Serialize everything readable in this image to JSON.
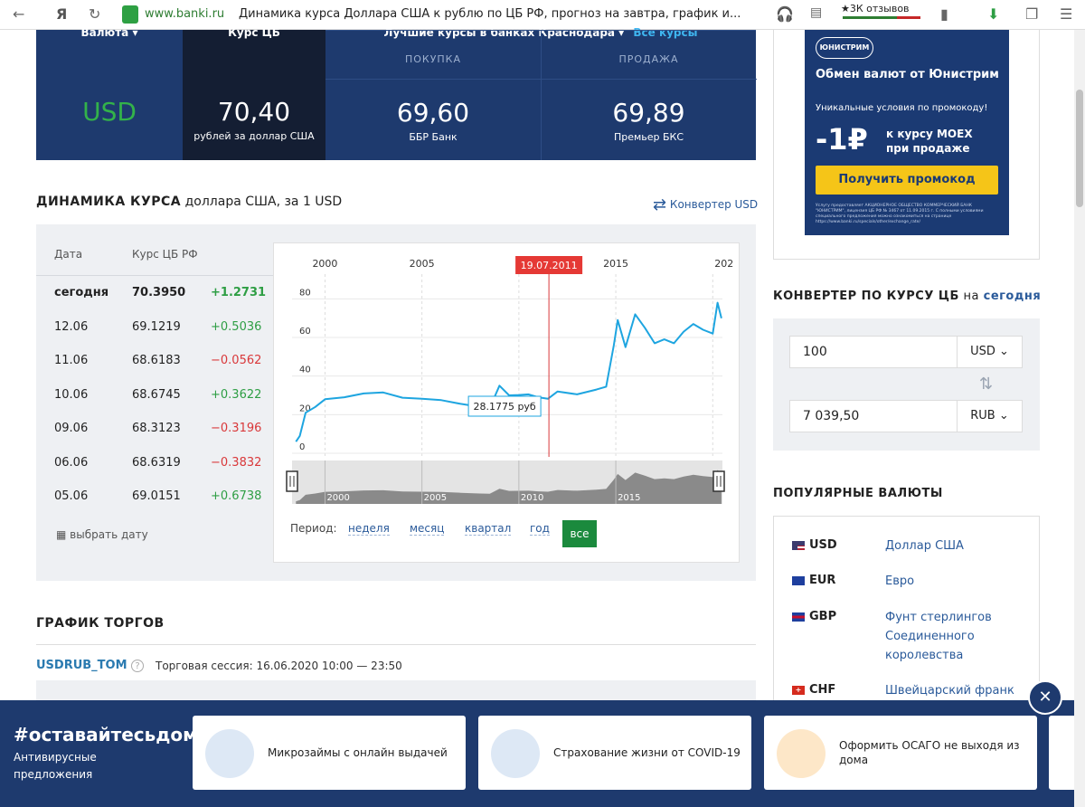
{
  "browser": {
    "host": "www.banki.ru",
    "tab_title": "Динамика курса Доллара США к рублю по ЦБ РФ, прогноз на завтра, график и...",
    "reviews": "★3К отзывов"
  },
  "rate_header": {
    "currency_tab": "Валюта ▾",
    "cb_tab": "Курс ЦБ",
    "best_tab": "Лучшие курсы в банках Краснодара ▾",
    "all_rates": "Все курсы",
    "buy_label": "ПОКУПКА",
    "sell_label": "ПРОДАЖА",
    "currency": "USD",
    "cb_rate": "70,40",
    "cb_sub": "рублей за доллар США",
    "buy_rate": "69,60",
    "buy_bank": "ББР Банк",
    "sell_rate": "69,89",
    "sell_bank": "Премьер БКС"
  },
  "dynamics": {
    "heading_bold": "ДИНАМИКА КУРСА",
    "heading_rest": " доллара США, за 1 USD",
    "converter_link": "Конвертер USD",
    "col_date": "Дата",
    "col_rate": "Курс ЦБ РФ",
    "rows": [
      {
        "date": "сегодня",
        "rate": "70.3950",
        "change": "+1.2731",
        "sign": "pos",
        "bold": true
      },
      {
        "date": "12.06",
        "rate": "69.1219",
        "change": "+0.5036",
        "sign": "pos"
      },
      {
        "date": "11.06",
        "rate": "68.6183",
        "change": "−0.0562",
        "sign": "neg"
      },
      {
        "date": "10.06",
        "rate": "68.6745",
        "change": "+0.3622",
        "sign": "pos"
      },
      {
        "date": "09.06",
        "rate": "68.3123",
        "change": "−0.3196",
        "sign": "neg"
      },
      {
        "date": "06.06",
        "rate": "68.6319",
        "change": "−0.3832",
        "sign": "neg"
      },
      {
        "date": "05.06",
        "rate": "69.0151",
        "change": "+0.6738",
        "sign": "pos"
      }
    ],
    "pick_date": "выбрать дату",
    "period_label": "Период:",
    "periods": [
      "неделя",
      "месяц",
      "квартал",
      "год"
    ],
    "period_all": "все"
  },
  "chart_data": {
    "type": "line",
    "x_years_top": [
      "2000",
      "2005",
      "2015",
      "202"
    ],
    "marker_date": "19.07.2011",
    "tooltip": "28.1775 руб",
    "ylim": [
      0,
      90
    ],
    "yticks": [
      "0",
      "20",
      "40",
      "60",
      "80"
    ],
    "navigator_years": [
      "2000",
      "2005",
      "2010",
      "2015"
    ],
    "series": [
      {
        "x": [
          1998.5,
          1998.7,
          1999.0,
          1999.5,
          2000.0,
          2001.0,
          2002.0,
          2003.0,
          2004.0,
          2005.0,
          2006.0,
          2007.0,
          2008.0,
          2008.5,
          2009.0,
          2009.5,
          2010.0,
          2010.5,
          2011.0,
          2011.5,
          2012.0,
          2013.0,
          2014.0,
          2014.5,
          2014.9,
          2015.1,
          2015.5,
          2016.0,
          2016.5,
          2017.0,
          2017.5,
          2018.0,
          2018.5,
          2019.0,
          2019.5,
          2020.0,
          2020.25,
          2020.45
        ],
        "y": [
          6,
          9,
          21,
          24,
          28,
          29,
          31,
          31.5,
          28.8,
          28.2,
          27.5,
          25.6,
          24,
          23.5,
          35,
          30,
          30.2,
          30.5,
          29,
          28.2,
          32,
          30.5,
          33,
          34.5,
          56,
          69,
          55,
          72,
          65,
          57,
          59,
          57,
          63,
          67,
          64,
          62,
          78,
          70
        ]
      }
    ]
  },
  "trade": {
    "heading": "ГРАФИК ТОРГОВ",
    "ticker": "USDRUB_TOM",
    "session": "Торговая сессия: 16.06.2020 10:00 — 23:50"
  },
  "promo_ad": {
    "brand": "ЮНИСТРИМ",
    "title": "Обмен валют от Юнистрим",
    "sub": "Уникальные условия по промокоду!",
    "big": "-1₽",
    "big_text": "к курсу MOEX при продаже",
    "button": "Получить промокод",
    "fine": "Услугу предоставляет АКЦИОНЕРНОЕ ОБЩЕСТВО КОММЕРЧЕСКИЙ БАНК \"ЮНИСТРИМ\", лицензия ЦБ РФ № 3467 от 11.09.2015 г. С полными условиями специального предложения можно ознакомиться на странице https://www.banki.ru/specials/other/exchange_rate/"
  },
  "converter": {
    "heading_bold": "КОНВЕРТЕР ПО КУРСУ ЦБ",
    "heading_mid": " на ",
    "heading_link": "сегодня",
    "amount": "100",
    "from": "USD",
    "result": "7 039,50",
    "to": "RUB"
  },
  "popular": {
    "heading": "ПОПУЛЯРНЫЕ ВАЛЮТЫ",
    "items": [
      {
        "code": "USD",
        "name": "Доллар США"
      },
      {
        "code": "EUR",
        "name": "Евро"
      },
      {
        "code": "GBP",
        "name": "Фунт стерлингов Соединенного королевства"
      },
      {
        "code": "CHF",
        "name": "Швейцарский франк"
      }
    ]
  },
  "banner": {
    "hashtag": "#оставайтесьдома",
    "sub": "Антивирусные предложения",
    "cards": [
      "Микрозаймы с онлайн выдачей",
      "Страхование жизни от COVID-19",
      "Оформить ОСАГО не выходя из дома"
    ],
    "close": "✕"
  }
}
